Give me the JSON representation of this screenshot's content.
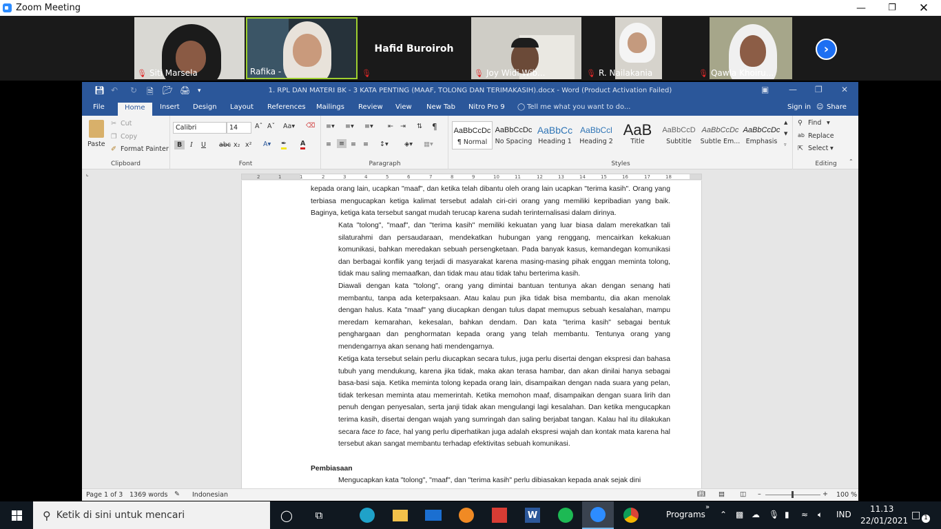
{
  "zoom": {
    "window_title": "Zoom Meeting",
    "participants": [
      {
        "name": "Siti Marsela"
      },
      {
        "name": "Rafika -"
      },
      {
        "name": "Hafid Buroiroh"
      },
      {
        "name": "Joy Widi Wib..."
      },
      {
        "name": "R. Nailakania"
      },
      {
        "name": "Qawla Khoiru..."
      }
    ]
  },
  "word": {
    "title": "1. RPL DAN MATERI BK - 3 KATA PENTING (MAAF, TOLONG DAN TERIMAKASIH).docx - Word (Product Activation Failed)",
    "tabs": [
      "File",
      "Home",
      "Insert",
      "Design",
      "Layout",
      "References",
      "Mailings",
      "Review",
      "View",
      "New Tab",
      "Nitro Pro 9"
    ],
    "tell_me": "Tell me what you want to do...",
    "sign_in": "Sign in",
    "share": "Share",
    "clipboard": {
      "paste": "Paste",
      "cut": "Cut",
      "copy": "Copy",
      "format_painter": "Format Painter",
      "label": "Clipboard"
    },
    "font": {
      "name": "Calibri",
      "size": "14",
      "label": "Font"
    },
    "paragraph_label": "Paragraph",
    "styles": {
      "items": [
        {
          "preview": "AaBbCcDc",
          "name": "¶ Normal"
        },
        {
          "preview": "AaBbCcDc",
          "name": "No Spacing"
        },
        {
          "preview": "AaBbCc",
          "name": "Heading 1"
        },
        {
          "preview": "AaBbCcl",
          "name": "Heading 2"
        },
        {
          "preview": "AaB",
          "name": "Title"
        },
        {
          "preview": "AaBbCcD",
          "name": "Subtitle"
        },
        {
          "preview": "AaBbCcDc",
          "name": "Subtle Em..."
        },
        {
          "preview": "AaBbCcDc",
          "name": "Emphasis"
        }
      ],
      "label": "Styles"
    },
    "editing": {
      "find": "Find",
      "replace": "Replace",
      "select": "Select",
      "label": "Editing"
    },
    "ruler_numbers": [
      "2",
      "1",
      "1",
      "2",
      "3",
      "4",
      "5",
      "6",
      "7",
      "8",
      "9",
      "10",
      "11",
      "12",
      "13",
      "14",
      "15",
      "16",
      "17",
      "18"
    ],
    "document": {
      "p1": "kepada orang lain, ucapkan \"maaf\", dan ketika telah dibantu oleh orang lain ucapkan \"terima kasih\". Orang yang terbiasa mengucapkan ketiga kalimat tersebut adalah ciri-ciri orang yang memiliki kepribadian yang baik. Baginya, ketiga kata tersebut sangat mudah terucap karena sudah terinternalisasi dalam dirinya.",
      "p2": "Kata \"tolong\", \"maaf\", dan \"terima kasih\" memiliki kekuatan yang luar biasa dalam merekatkan tali silaturahmi dan persaudaraan, mendekatkan hubungan yang renggang, mencairkan kekakuan komunikasi, bahkan meredakan sebuah persengketaan. Pada banyak kasus, kemandegan komunikasi dan berbagai konflik yang terjadi di masyarakat karena masing-masing pihak enggan meminta tolong, tidak mau saling memaafkan, dan tidak mau atau tidak tahu berterima kasih.",
      "p3": "Diawali dengan kata \"tolong\", orang yang dimintai bantuan tentunya akan dengan senang hati membantu, tanpa ada keterpaksaan. Atau kalau pun jika tidak bisa membantu, dia akan menolak dengan halus. Kata \"maaf\" yang diucapkan dengan tulus dapat memupus sebuah kesalahan, mampu meredam kemarahan, kekesalan, bahkan dendam. Dan kata \"terima kasih\" sebagai bentuk penghargaan dan penghormatan kepada orang yang telah membantu. Tentunya orang yang mendengarnya akan senang hati mendengarnya.",
      "p4a": "Ketiga kata tersebut selain perlu diucapkan secara tulus, juga perlu disertai dengan ekspresi dan bahasa tubuh yang mendukung, karena jika tidak, maka akan terasa hambar, dan akan dinilai hanya sebagai basa-basi saja. Ketika meminta tolong kepada orang lain, disampaikan dengan nada suara yang pelan, tidak terkesan meminta atau memerintah. Ketika memohon maaf, disampaikan dengan suara lirih dan penuh dengan penyesalan, serta janji tidak akan mengulangi lagi kesalahan. Dan ketika mengucapkan terima kasih, disertai dengan wajah yang sumringah dan saling berjabat tangan. Kalau hal itu dilakukan secara ",
      "p4_italic": "face to face,",
      "p4b": " hal yang perlu diperhatikan juga adalah ekspresi wajah dan kontak mata karena hal tersebut akan sangat membantu terhadap efektivitas sebuah komunikasi.",
      "heading": "Pembiasaan",
      "p5": "Mengucapkan kata \"tolong\", \"maaf\", dan \"terima kasih\" perlu dibiasakan kepada anak sejak dini"
    },
    "status": {
      "page": "Page 1 of 3",
      "words": "1369 words",
      "language": "Indonesian",
      "zoom": "100 %"
    }
  },
  "taskbar": {
    "search_placeholder": "Ketik di sini untuk mencari",
    "programs": "Programs",
    "lang": "IND",
    "time": "11.13",
    "date": "22/01/2021",
    "notifications": "1"
  }
}
